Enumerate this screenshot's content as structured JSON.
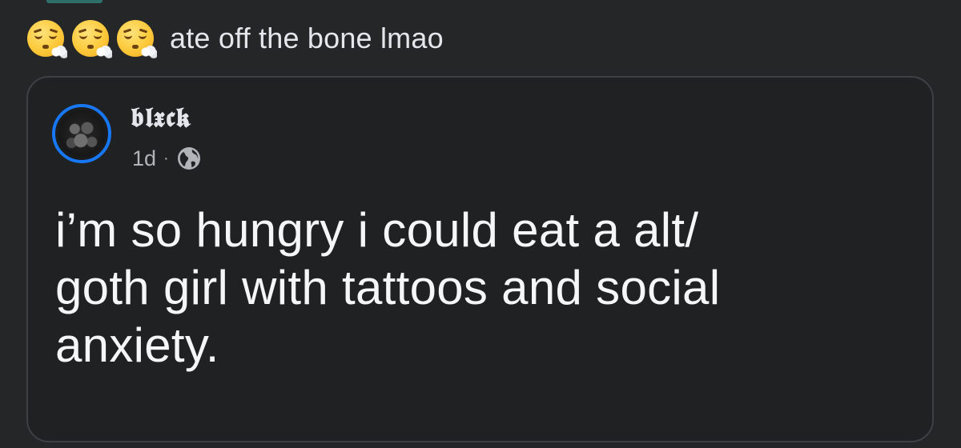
{
  "caption": {
    "emojis": [
      "face-exhaling-emoji",
      "face-exhaling-emoji",
      "face-exhaling-emoji"
    ],
    "text": "ate off the bone lmao"
  },
  "shared_post": {
    "author": "𝖇𝖑𝖝𝖈𝖐",
    "time": "1d",
    "separator": "·",
    "audience_icon": "globe-icon",
    "body_lines": [
      "i’m so hungry i could eat a alt/",
      "goth girl with tattoos and social",
      "anxiety."
    ]
  },
  "colors": {
    "background": "#252628",
    "card_border": "#3f4043",
    "avatar_ring": "#1877f2",
    "text": "#e4e6eb",
    "muted": "#b0b3b8"
  }
}
